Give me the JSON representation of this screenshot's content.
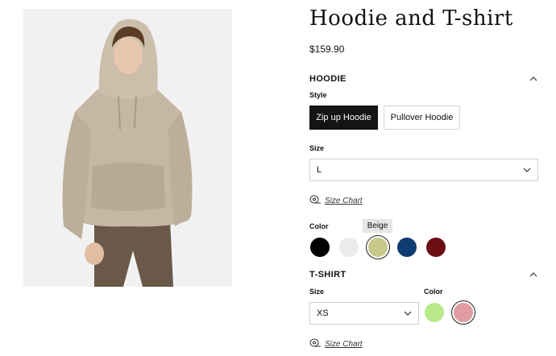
{
  "product": {
    "title": "Hoodie and T-shirt",
    "price": "$159.90",
    "image_alt": "Model wearing beige hoodie"
  },
  "hoodie": {
    "section_label": "HOODIE",
    "style_label": "Style",
    "styles": [
      {
        "label": "Zip up Hoodie",
        "selected": true
      },
      {
        "label": "Pullover Hoodie",
        "selected": false
      }
    ],
    "size_label": "Size",
    "size_value": "L",
    "size_chart": "Size Chart",
    "color_label": "Color",
    "color_tooltip": "Beige",
    "colors": [
      {
        "name": "Black",
        "hex": "#000000"
      },
      {
        "name": "White",
        "hex": "#ebebeb"
      },
      {
        "name": "Beige",
        "hex": "#c8c98a",
        "selected": true
      },
      {
        "name": "Navy",
        "hex": "#0f3b73"
      },
      {
        "name": "Burgundy",
        "hex": "#6b0f14"
      }
    ]
  },
  "tshirt": {
    "section_label": "T-SHIRT",
    "size_label": "Size",
    "size_value": "XS",
    "color_label": "Color",
    "colors": [
      {
        "name": "Lime",
        "hex": "#b7e88a"
      },
      {
        "name": "Pink",
        "hex": "#e09ca0",
        "selected": true
      }
    ],
    "size_chart": "Size Chart"
  },
  "icons": {
    "collapse": "chevron-up-icon",
    "dropdown": "chevron-down-icon",
    "size_chart": "tape-measure-icon"
  }
}
